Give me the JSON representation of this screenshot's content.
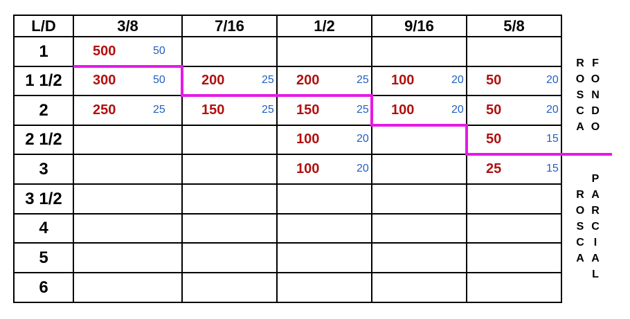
{
  "header": {
    "corner": "L/D",
    "columns": [
      "3/8",
      "7/16",
      "1/2",
      "9/16",
      "5/8"
    ]
  },
  "rows": [
    {
      "label": "1",
      "cells": [
        {
          "qty": "500",
          "pack": "50"
        },
        null,
        null,
        null,
        null
      ]
    },
    {
      "label": "1 1/2",
      "cells": [
        {
          "qty": "300",
          "pack": "50"
        },
        {
          "qty": "200",
          "pack": "25"
        },
        {
          "qty": "200",
          "pack": "25"
        },
        {
          "qty": "100",
          "pack": "20"
        },
        {
          "qty": "50",
          "pack": "20"
        }
      ]
    },
    {
      "label": "2",
      "cells": [
        {
          "qty": "250",
          "pack": "25"
        },
        {
          "qty": "150",
          "pack": "25"
        },
        {
          "qty": "150",
          "pack": "25"
        },
        {
          "qty": "100",
          "pack": "20"
        },
        {
          "qty": "50",
          "pack": "20"
        }
      ]
    },
    {
      "label": "2 1/2",
      "cells": [
        null,
        null,
        {
          "qty": "100",
          "pack": "20"
        },
        null,
        {
          "qty": "50",
          "pack": "15"
        }
      ]
    },
    {
      "label": "3",
      "cells": [
        null,
        null,
        {
          "qty": "100",
          "pack": "20"
        },
        null,
        {
          "qty": "25",
          "pack": "15"
        }
      ]
    },
    {
      "label": "3 1/2",
      "cells": [
        null,
        null,
        null,
        null,
        null
      ]
    },
    {
      "label": "4",
      "cells": [
        null,
        null,
        null,
        null,
        null
      ]
    },
    {
      "label": "5",
      "cells": [
        null,
        null,
        null,
        null,
        null
      ]
    },
    {
      "label": "6",
      "cells": [
        null,
        null,
        null,
        null,
        null
      ]
    }
  ],
  "side_labels": {
    "rosca_fondo": {
      "left": "ROSCA",
      "right": "FONDO"
    },
    "rosca_parcial": {
      "left": "ROSCA",
      "right": "PARCIAL"
    }
  },
  "colors": {
    "quantity": "#b01010",
    "package": "#1f5fbf",
    "boundary_line": "#e619e6",
    "grid": "#000000"
  }
}
